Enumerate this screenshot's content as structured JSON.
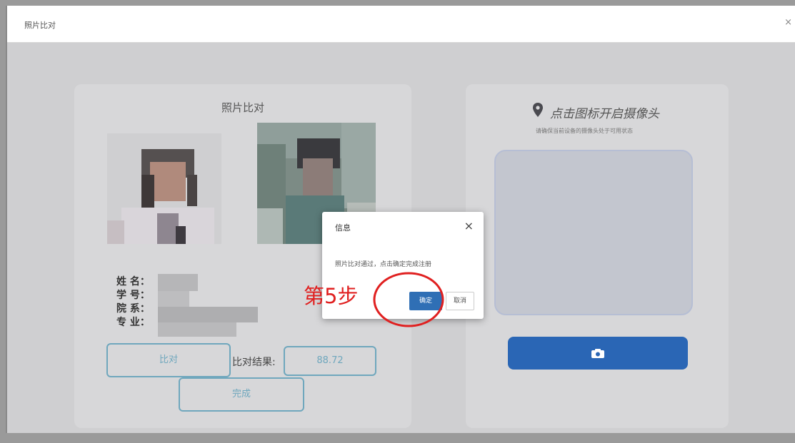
{
  "window": {
    "title": "照片比对",
    "close_label": "×"
  },
  "left_card": {
    "heading": "照片比对",
    "fields": {
      "name_label": "姓 名：",
      "student_id_label": "学 号：",
      "department_label": "院 系：",
      "major_label": "专 业："
    },
    "compare_button": "比对",
    "result_label": "比对结果:",
    "result_value": "88.72",
    "finish_button": "完成"
  },
  "right_card": {
    "hint": "点击图标开启摄像头",
    "sub_hint": "请确保当前设备的摄像头处于可用状态",
    "camera_icon": "camera-icon",
    "location_icon": "location-pin-icon"
  },
  "dialog": {
    "title": "信息",
    "close_label": "×",
    "message": "照片比对通过，点击确定完成注册",
    "ok_label": "确定",
    "cancel_label": "取消"
  },
  "annotation": {
    "step_text": "第5步"
  },
  "colors": {
    "accent": "#2a66b5",
    "outline": "#6fa7bd",
    "annotation": "#e02020"
  }
}
